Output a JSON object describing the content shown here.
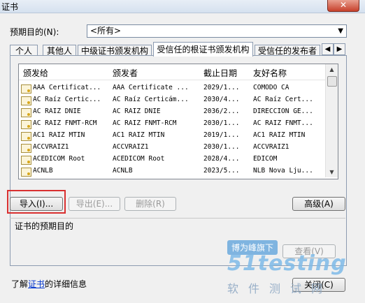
{
  "window": {
    "title": "证书",
    "close_glyph": "✕"
  },
  "purpose": {
    "label": "预期目的(N):",
    "value": "<所有>"
  },
  "tabs": [
    {
      "label": "个人"
    },
    {
      "label": "其他人"
    },
    {
      "label": "中级证书颁发机构"
    },
    {
      "label": "受信任的根证书颁发机构"
    },
    {
      "label": "受信任的发布者"
    }
  ],
  "columns": {
    "issued_to": "颁发给",
    "issued_by": "颁发者",
    "expires": "截止日期",
    "friendly": "友好名称"
  },
  "certs": [
    {
      "to": "AAA Certificat...",
      "by": "AAA Certificate ...",
      "exp": "2029/1...",
      "name": "COMODO CA"
    },
    {
      "to": "AC Raíz Certic...",
      "by": "AC Raíz Certicám...",
      "exp": "2030/4...",
      "name": "AC Raíz Cert..."
    },
    {
      "to": "AC RAIZ DNIE",
      "by": "AC RAIZ DNIE",
      "exp": "2036/2...",
      "name": "DIRECCION GE..."
    },
    {
      "to": "AC RAIZ FNMT-RCM",
      "by": "AC RAIZ FNMT-RCM",
      "exp": "2030/1...",
      "name": "AC RAIZ FNMT..."
    },
    {
      "to": "AC1 RAIZ MTIN",
      "by": "AC1 RAIZ MTIN",
      "exp": "2019/1...",
      "name": "AC1 RAIZ MTIN"
    },
    {
      "to": "ACCVRAIZ1",
      "by": "ACCVRAIZ1",
      "exp": "2030/1...",
      "name": "ACCVRAIZ1"
    },
    {
      "to": "ACEDICOM Root",
      "by": "ACEDICOM Root",
      "exp": "2028/4...",
      "name": "EDICOM"
    },
    {
      "to": "ACNLB",
      "by": "ACNLB",
      "exp": "2023/5...",
      "name": "NLB Nova Lju..."
    }
  ],
  "buttons": {
    "import": "导入(I)...",
    "export": "导出(E)...",
    "remove": "删除(R)",
    "advanced": "高级(A)",
    "view": "查看(V)",
    "close": "关闭(C)"
  },
  "purposes_group": {
    "legend": "证书的预期目的"
  },
  "learn": {
    "prefix": "了解",
    "link": "证书",
    "suffix": "的详细信息"
  },
  "watermark": {
    "badge": "博为峰旗下",
    "logo": "51testing",
    "sub": "软件测试网"
  },
  "icons": {
    "tab_left": "◀",
    "tab_right": "▶",
    "dropdown": "▼",
    "scroll_up": "▲",
    "scroll_down": "▼"
  }
}
